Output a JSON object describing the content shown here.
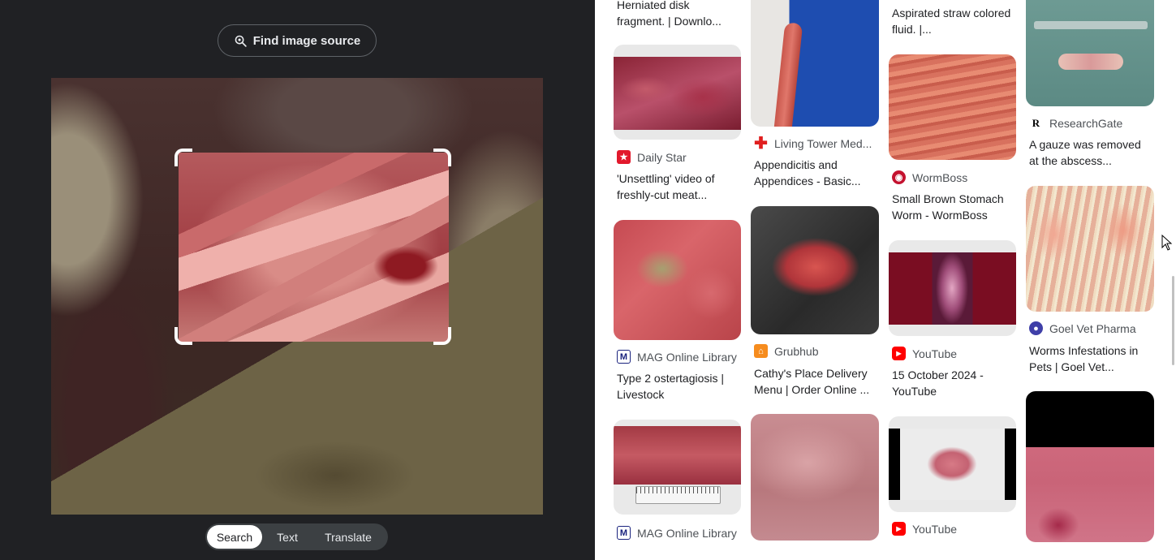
{
  "lens": {
    "find_source_label": "Find image source",
    "modes": [
      "Search",
      "Text",
      "Translate"
    ],
    "active_mode": "Search"
  },
  "colors": {
    "background_dark": "#202124",
    "toggle_bg": "#3c4043",
    "text_light": "#e8eaed"
  },
  "results": {
    "col1": [
      {
        "title": "Herniated disk fragment.  | Downlo..."
      },
      {
        "source": "Daily Star",
        "favicon": "daily-star-icon",
        "title": "'Unsettling' video of freshly-cut meat..."
      },
      {
        "source": "MAG Online Library",
        "favicon": "mag-online-library-icon",
        "title": "Type 2 ostertagiosis | Livestock"
      },
      {
        "source": "MAG Online Library",
        "favicon": "mag-online-library-icon",
        "title": ""
      }
    ],
    "col2": [
      {
        "source": "Living Tower Med...",
        "favicon": "red-cross-icon",
        "title": "Appendicitis and Appendices - Basic..."
      },
      {
        "source": "Grubhub",
        "favicon": "grubhub-icon",
        "title": "Cathy's Place Delivery Menu | Order Online ..."
      },
      {
        "source": "",
        "title": ""
      }
    ],
    "col3": [
      {
        "title": "Aspirated straw colored fluid. |..."
      },
      {
        "source": "WormBoss",
        "favicon": "wormboss-icon",
        "title": "Small Brown Stomach Worm - WormBoss"
      },
      {
        "source": "YouTube",
        "favicon": "youtube-icon",
        "title": "15 October 2024 - YouTube"
      },
      {
        "source": "YouTube",
        "favicon": "youtube-icon",
        "title": ""
      }
    ],
    "col4": [
      {
        "source": "ResearchGate",
        "favicon": "researchgate-icon",
        "title": "A gauze was removed at the abscess..."
      },
      {
        "source": "Goel Vet Pharma",
        "favicon": "goel-vet-pharma-icon",
        "title": "Worms Infestations in Pets | Goel Vet..."
      },
      {
        "source": "",
        "title": ""
      }
    ]
  }
}
